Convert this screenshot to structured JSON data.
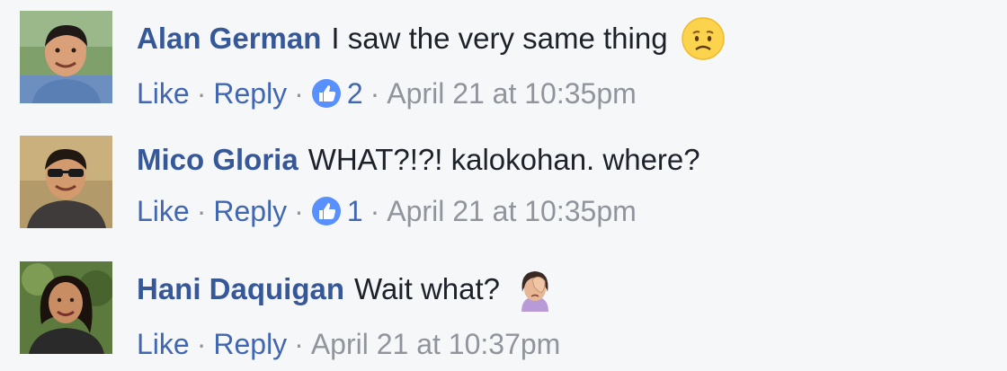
{
  "colors": {
    "author_link": "#365899",
    "action_link": "#4267b2",
    "meta_gray": "#90949c",
    "like_blue": "#5890ff",
    "background": "#f6f7f9"
  },
  "comments": [
    {
      "author": "Alan German",
      "text": "I saw the very same thing",
      "emoji": "worried-face-emoji",
      "like_label": "Like",
      "reply_label": "Reply",
      "likes": "2",
      "timestamp": "April 21 at 10:35pm"
    },
    {
      "author": "Mico Gloria",
      "text": "WHAT?!?! kalokohan. where?",
      "like_label": "Like",
      "reply_label": "Reply",
      "likes": "1",
      "timestamp": "April 21 at 10:35pm"
    },
    {
      "author": "Hani Daquigan",
      "text": "Wait what?",
      "emoji": "face-palm-emoji",
      "like_label": "Like",
      "reply_label": "Reply",
      "timestamp": "April 21 at 10:37pm"
    }
  ],
  "separator": "·"
}
